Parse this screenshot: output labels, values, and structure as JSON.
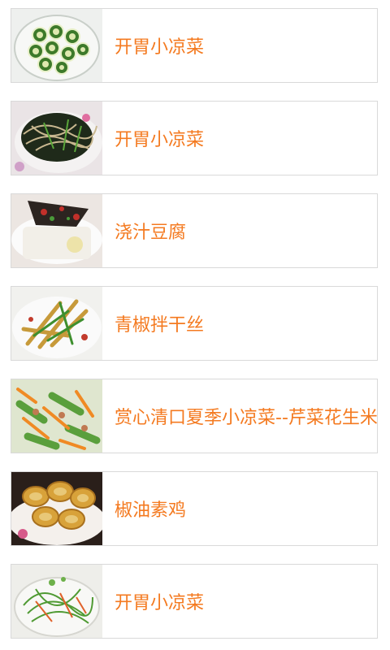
{
  "recipes": [
    {
      "title": "开胃小凉菜",
      "image_icon": "cucumber-salad-photo"
    },
    {
      "title": "开胃小凉菜",
      "image_icon": "seaweed-noodle-salad-photo"
    },
    {
      "title": "浇汁豆腐",
      "image_icon": "tofu-with-sauce-photo"
    },
    {
      "title": "青椒拌干丝",
      "image_icon": "pepper-tofu-strips-photo"
    },
    {
      "title": "赏心清口夏季小凉菜--芹菜花生米",
      "image_icon": "celery-peanut-salad-photo"
    },
    {
      "title": "椒油素鸡",
      "image_icon": "pepper-oil-tofu-roll-photo"
    },
    {
      "title": "开胃小凉菜",
      "image_icon": "shredded-vegetable-salad-photo"
    }
  ],
  "colors": {
    "title": "#f47a20",
    "card_border": "#d9d9d9"
  }
}
